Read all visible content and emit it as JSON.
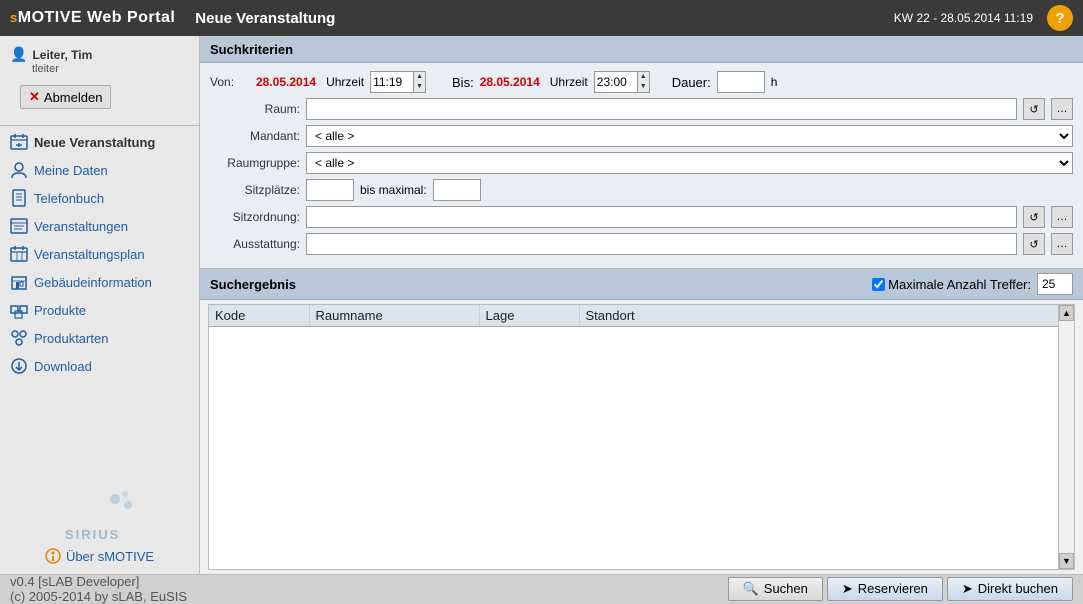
{
  "header": {
    "logo": "sMOTIVE Web Portal",
    "logo_highlight": "s",
    "page_title": "Neue Veranstaltung",
    "datetime": "KW 22 - 28.05.2014 11:19",
    "help_label": "?"
  },
  "sidebar": {
    "user_name": "Leiter, Tim",
    "user_login": "tleiter",
    "logout_label": "Abmelden",
    "items": [
      {
        "id": "neue-veranstaltung",
        "label": "Neue Veranstaltung",
        "active": true
      },
      {
        "id": "meine-daten",
        "label": "Meine Daten",
        "active": false
      },
      {
        "id": "telefonbuch",
        "label": "Telefonbuch",
        "active": false
      },
      {
        "id": "veranstaltungen",
        "label": "Veranstaltungen",
        "active": false
      },
      {
        "id": "veranstaltungsplan",
        "label": "Veranstaltungsplan",
        "active": false
      },
      {
        "id": "gebaeudeinformation",
        "label": "Gebäudeinformation",
        "active": false
      },
      {
        "id": "produkte",
        "label": "Produkte",
        "active": false
      },
      {
        "id": "produktarten",
        "label": "Produktarten",
        "active": false
      },
      {
        "id": "download",
        "label": "Download",
        "active": false
      }
    ],
    "uber_label": "Über sMOTIVE",
    "sirius_label": "SIRIUS"
  },
  "search_criteria": {
    "section_label": "Suchkriterien",
    "von_label": "Von:",
    "von_date": "28.05.2014",
    "uhrzeit_label": "Uhrzeit",
    "von_time": "11:19",
    "bis_label": "Bis:",
    "bis_date": "28.05.2014",
    "bis_time": "23:00",
    "dauer_label": "Dauer:",
    "dauer_unit": "h",
    "dauer_value": "",
    "raum_label": "Raum:",
    "raum_value": "",
    "mandant_label": "Mandant:",
    "mandant_value": "< alle >",
    "raumgruppe_label": "Raumgruppe:",
    "raumgruppe_value": "< alle >",
    "sitzplaetze_label": "Sitzplätze:",
    "sitzplaetze_value": "",
    "bis_maximal_label": "bis maximal:",
    "sitzplaetze_max": "",
    "sitzordnung_label": "Sitzordnung:",
    "sitzordnung_value": "",
    "ausstattung_label": "Ausstattung:",
    "ausstattung_value": ""
  },
  "results": {
    "section_label": "Suchergebnis",
    "max_hits_label": "Maximale Anzahl Treffer:",
    "max_hits_value": "25",
    "max_hits_checked": true,
    "columns": [
      "Kode",
      "Raumname",
      "Lage",
      "Standort"
    ],
    "rows": []
  },
  "footer": {
    "version_line1": "v0.4 [sLAB Developer]",
    "version_line2": "(c) 2005-2014 by sLAB, EuSIS",
    "btn_search": "Suchen",
    "btn_reserve": "Reservieren",
    "btn_direct": "Direkt buchen"
  }
}
